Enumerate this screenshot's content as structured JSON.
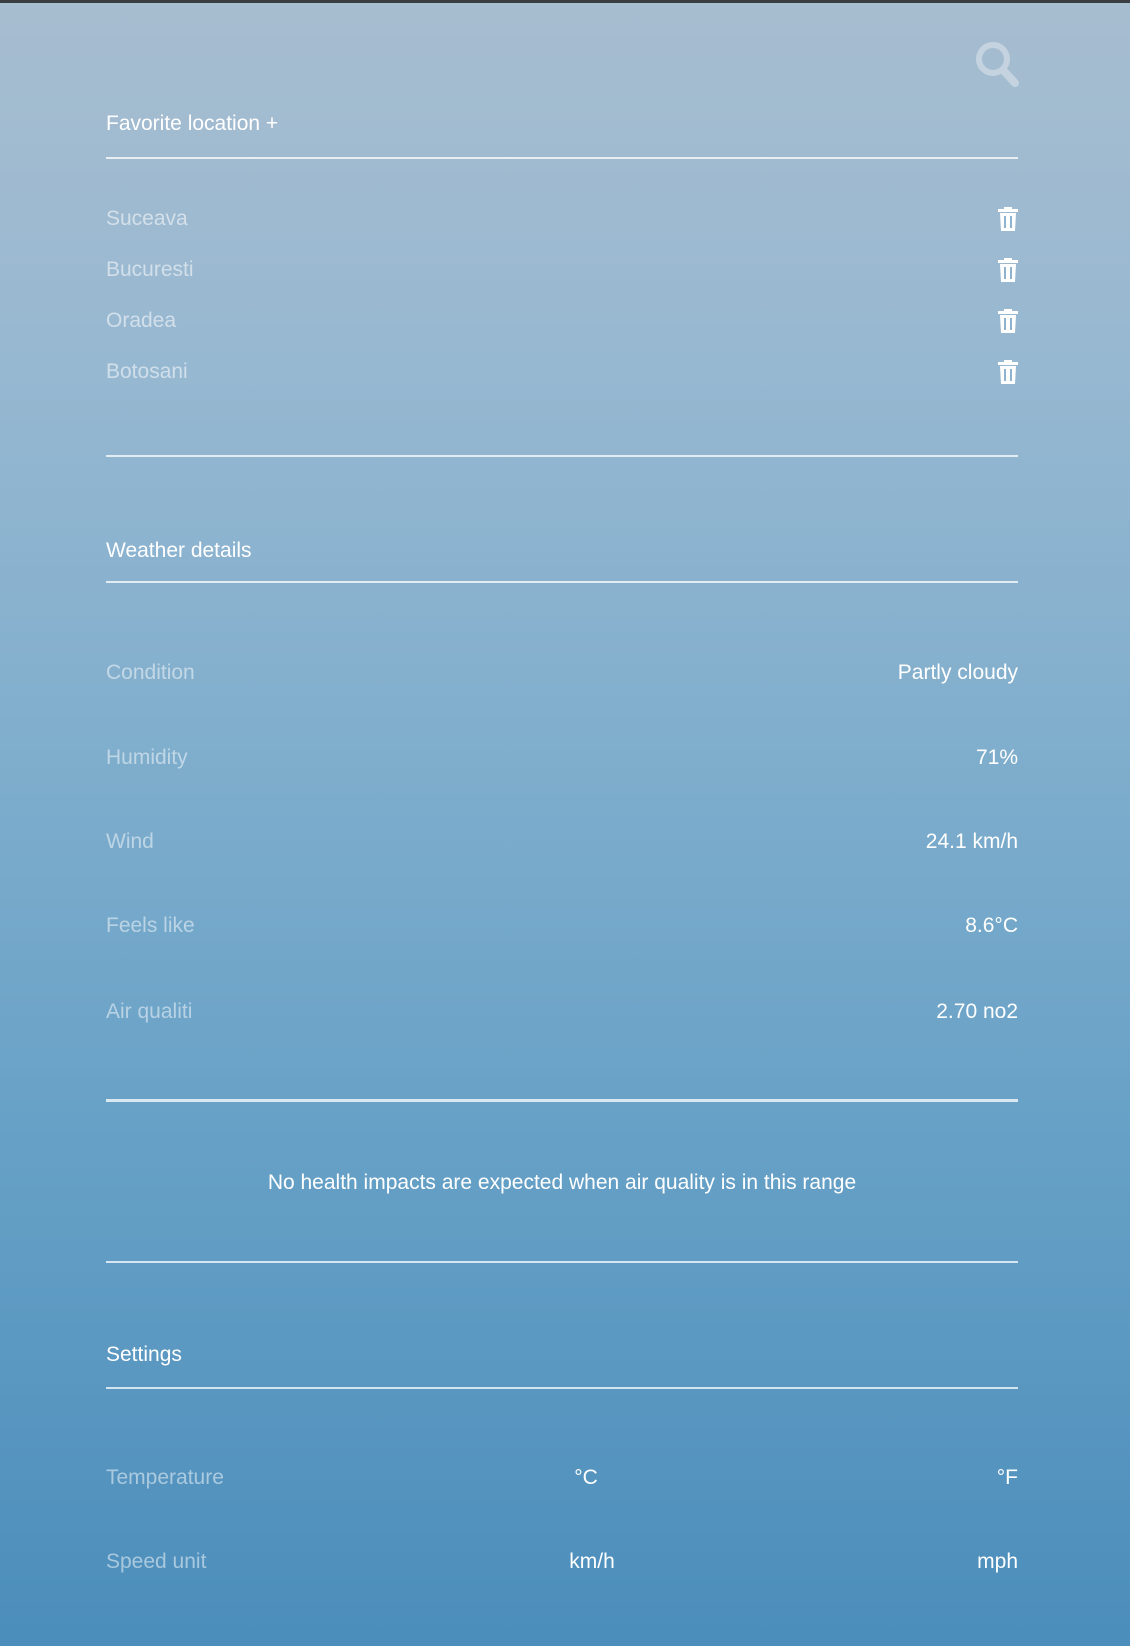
{
  "header": {
    "search_icon": "search-icon"
  },
  "favorites": {
    "title": "Favorite location +",
    "items": [
      {
        "name": "Suceava",
        "delete_icon": "trash-icon"
      },
      {
        "name": "Bucuresti",
        "delete_icon": "trash-icon"
      },
      {
        "name": "Oradea",
        "delete_icon": "trash-icon"
      },
      {
        "name": "Botosani",
        "delete_icon": "trash-icon"
      }
    ]
  },
  "weather_details": {
    "title": "Weather details",
    "rows": [
      {
        "label": "Condition",
        "value": "Partly cloudy"
      },
      {
        "label": "Humidity",
        "value": "71%"
      },
      {
        "label": "Wind",
        "value": "24.1 km/h"
      },
      {
        "label": "Feels like",
        "value": "8.6°C"
      },
      {
        "label": "Air qualiti",
        "value": "2.70 no2"
      }
    ],
    "health_note": "No health impacts are expected when air quality is in this range"
  },
  "settings": {
    "title": "Settings",
    "temperature": {
      "label": "Temperature",
      "option_1": "°C",
      "option_2": "°F"
    },
    "speed_unit": {
      "label": "Speed unit",
      "option_1": "km/h",
      "option_2": "mph"
    }
  },
  "colors": {
    "gradient_top": "#a7bdd0",
    "gradient_bottom": "#4b8dbb",
    "text_primary": "#ffffff",
    "top_bar": "#3a3d41"
  }
}
